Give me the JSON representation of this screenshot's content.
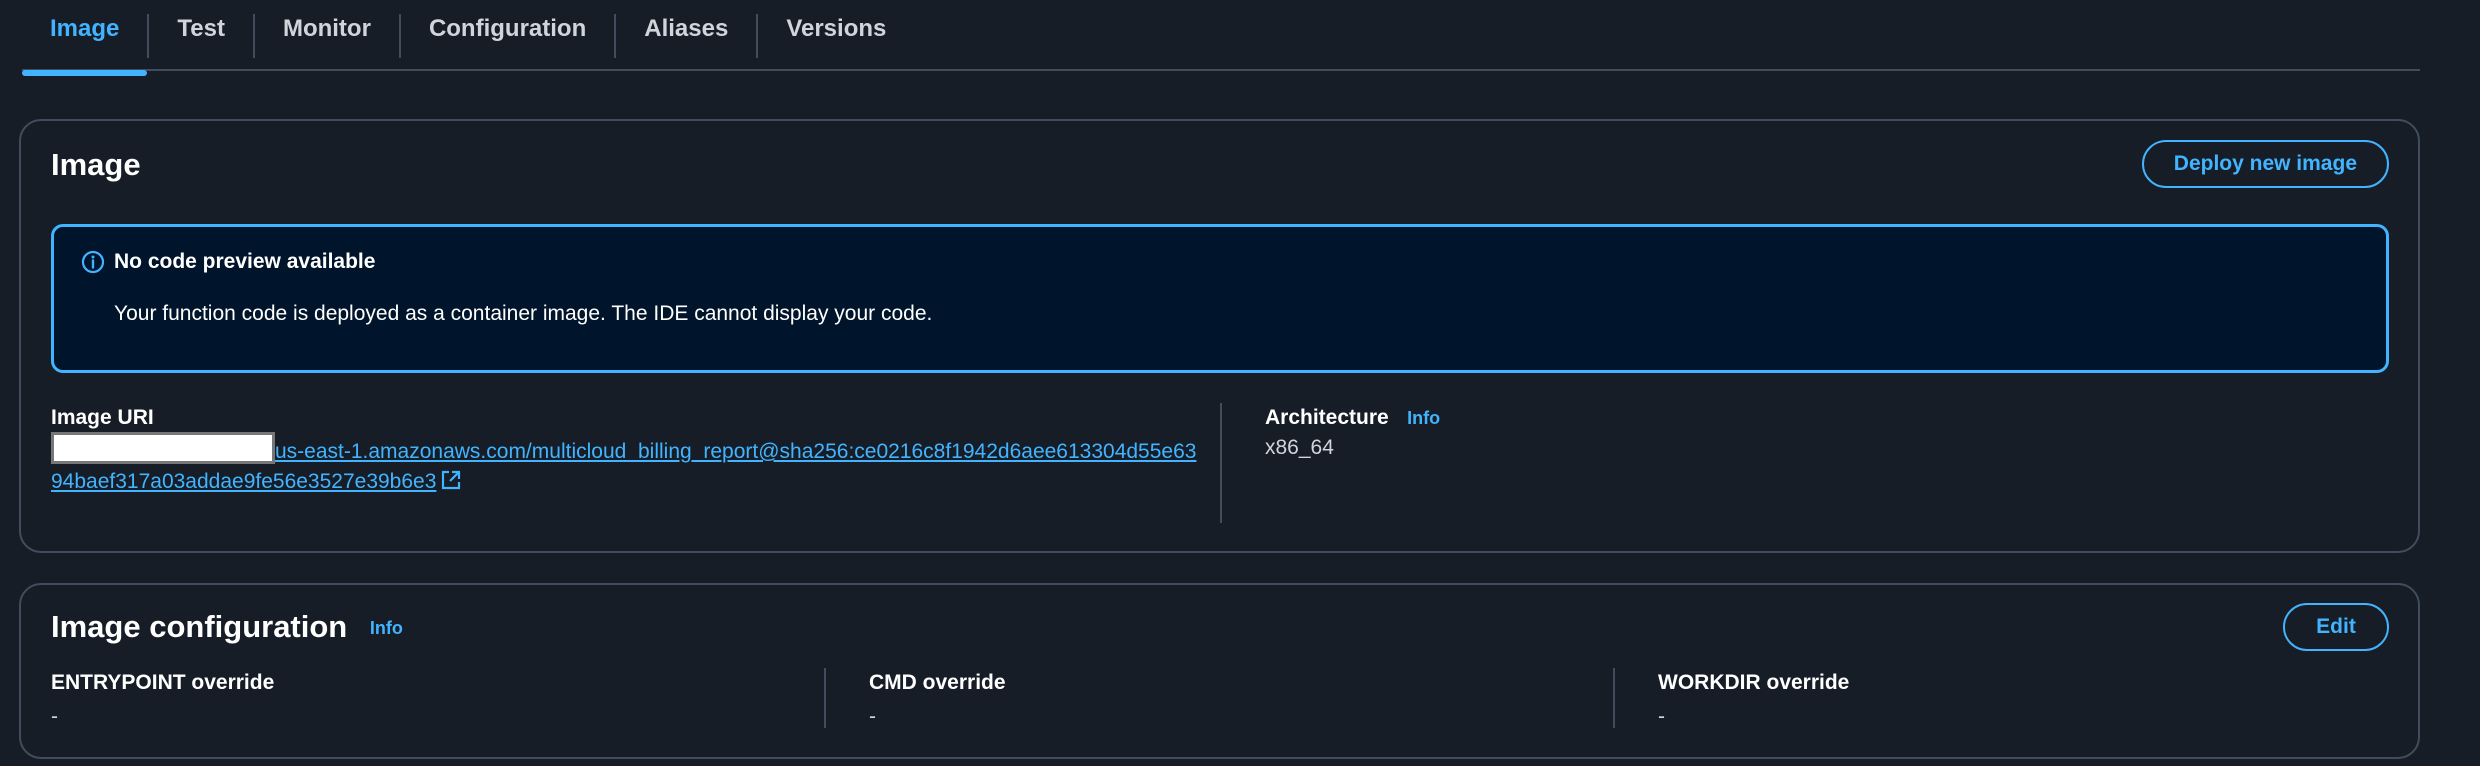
{
  "tabs": [
    {
      "label": "Image",
      "active": true
    },
    {
      "label": "Test",
      "active": false
    },
    {
      "label": "Monitor",
      "active": false
    },
    {
      "label": "Configuration",
      "active": false
    },
    {
      "label": "Aliases",
      "active": false
    },
    {
      "label": "Versions",
      "active": false
    }
  ],
  "image_panel": {
    "title": "Image",
    "deploy_button": "Deploy new image",
    "alert": {
      "icon": "info-circle-icon",
      "title": "No code preview available",
      "body": "Your function code is deployed as a container image. The IDE cannot display your code."
    },
    "image_uri": {
      "label": "Image URI",
      "value_visible": "us-east-1.amazonaws.com/multicloud_billing_report@sha256:ce0216c8f1942d6aee613304d55e6394baef317a03addae9fe56e3527e39b6e3",
      "external_icon": "external-link-icon"
    },
    "architecture": {
      "label": "Architecture",
      "info": "Info",
      "value": "x86_64"
    }
  },
  "config_panel": {
    "title": "Image configuration",
    "info": "Info",
    "edit_button": "Edit",
    "fields": [
      {
        "label": "ENTRYPOINT override",
        "value": "-"
      },
      {
        "label": "CMD override",
        "value": "-"
      },
      {
        "label": "WORKDIR override",
        "value": "-"
      }
    ]
  },
  "colors": {
    "background": "#161d26",
    "accent": "#42b4ff",
    "alert_background": "#00142b",
    "border": "#414d5c"
  }
}
